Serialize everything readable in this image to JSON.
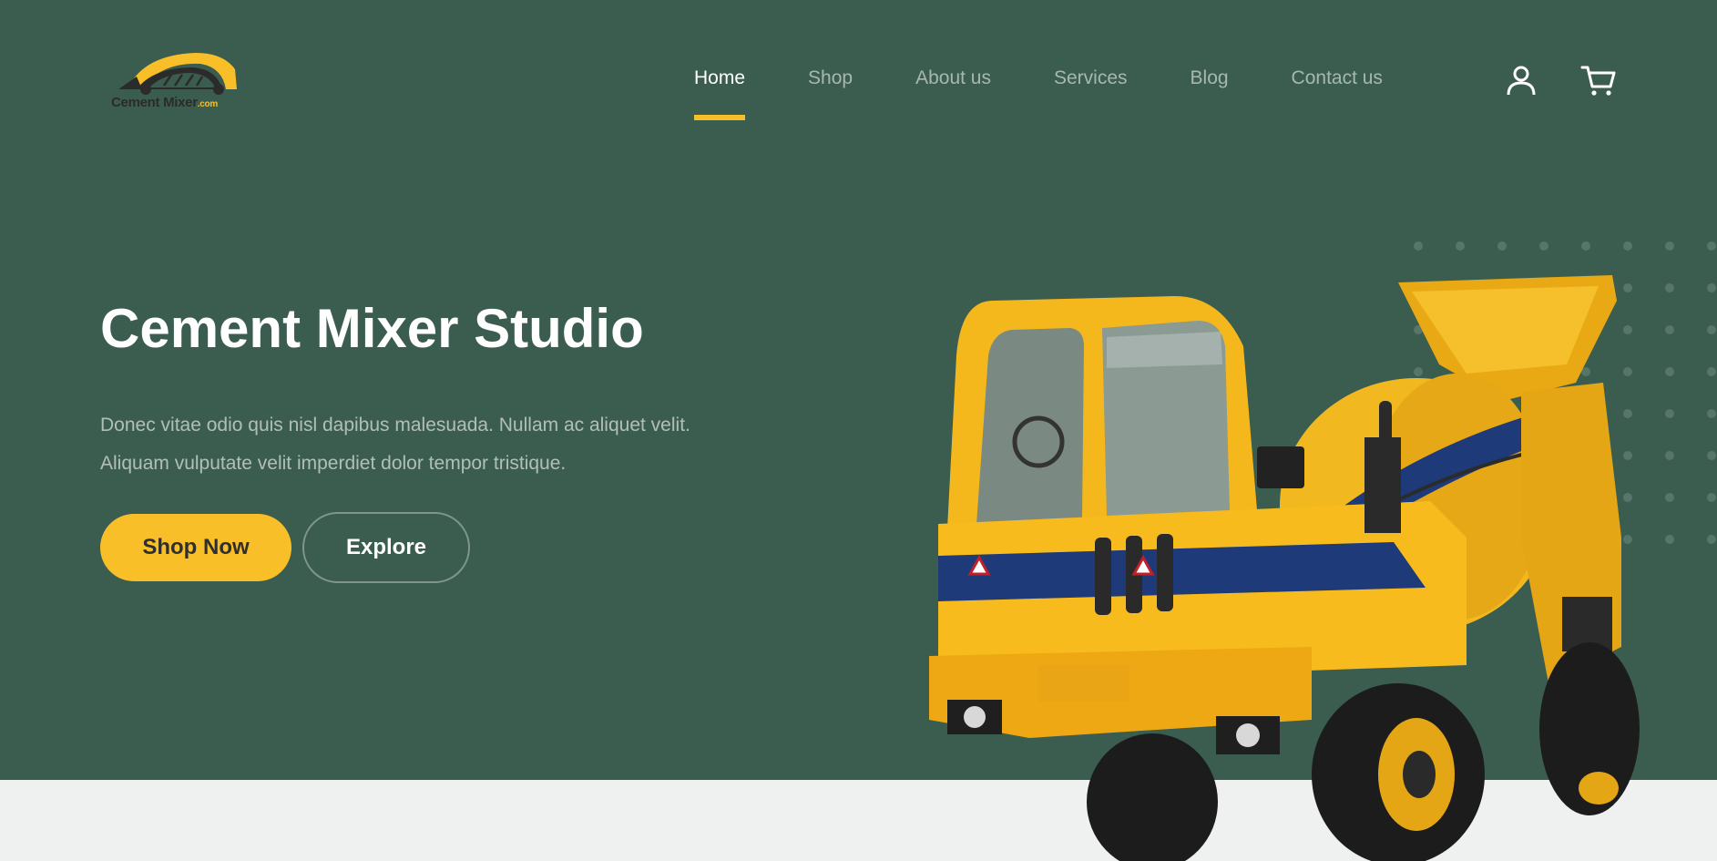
{
  "logo": {
    "text": "Cement Mixer",
    "suffix": ".com"
  },
  "nav": {
    "items": [
      {
        "label": "Home",
        "active": true
      },
      {
        "label": "Shop",
        "active": false
      },
      {
        "label": "About us",
        "active": false
      },
      {
        "label": "Services",
        "active": false
      },
      {
        "label": "Blog",
        "active": false
      },
      {
        "label": "Contact us",
        "active": false
      }
    ],
    "icons": [
      "user-icon",
      "cart-icon"
    ]
  },
  "hero": {
    "title": "Cement Mixer Studio",
    "description": "Donec vitae odio quis nisl dapibus malesuada. Nullam ac aliquet velit. Aliquam vulputate velit imperdiet dolor tempor tristique.",
    "primary_button": "Shop Now",
    "secondary_button": "Explore"
  },
  "colors": {
    "hero_background": "#3b5d50",
    "accent": "#f9bf29",
    "lower_background": "#eff1f0"
  }
}
